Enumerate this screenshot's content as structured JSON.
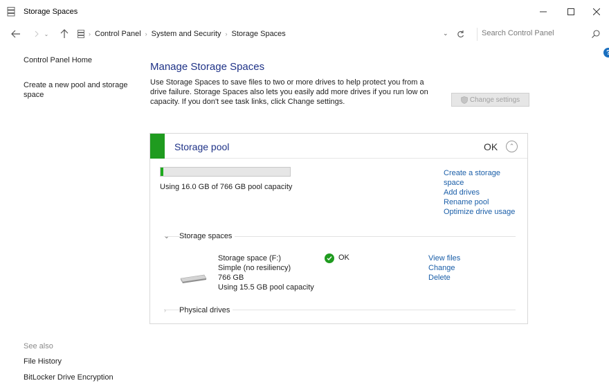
{
  "window": {
    "title": "Storage Spaces",
    "icon": "storage-spaces-icon",
    "controls": [
      "minimize-icon",
      "maximize-icon",
      "close-icon"
    ]
  },
  "navigation": {
    "breadcrumbs": [
      "Control Panel",
      "System and Security",
      "Storage Spaces"
    ],
    "search": {
      "placeholder": "Search Control Panel",
      "value": ""
    }
  },
  "sidebar": {
    "home_label": "Control Panel Home",
    "create_pool_label": "Create a new pool and storage space",
    "see_also_label": "See also",
    "see_also_items": [
      "File History",
      "BitLocker Drive Encryption"
    ]
  },
  "main": {
    "heading": "Manage Storage Spaces",
    "intro": "Use Storage Spaces to save files to two or more drives to help protect you from a drive failure. Storage Spaces also lets you easily add more drives if you run low on capacity. If you don't see task links, click Change settings.",
    "change_settings_label": "Change settings"
  },
  "pool": {
    "title": "Storage pool",
    "status": "OK",
    "usage_fraction": 0.021,
    "usage_text": "Using 16.0 GB of 766 GB pool capacity",
    "links": [
      "Create a storage space",
      "Add drives",
      "Rename pool",
      "Optimize drive usage"
    ],
    "storage_spaces_label": "Storage spaces",
    "physical_drives_label": "Physical drives",
    "space": {
      "name": "Storage space (F:)",
      "resiliency": "Simple (no resiliency)",
      "size": "766 GB",
      "usage": "Using 15.5 GB pool capacity",
      "status": "OK",
      "links": [
        "View files",
        "Change",
        "Delete"
      ]
    }
  },
  "colors": {
    "accent_green": "#1f9b1f",
    "heading_blue": "#1e3287",
    "link_blue": "#1a5ea8",
    "help_blue": "#1a6fbf"
  }
}
